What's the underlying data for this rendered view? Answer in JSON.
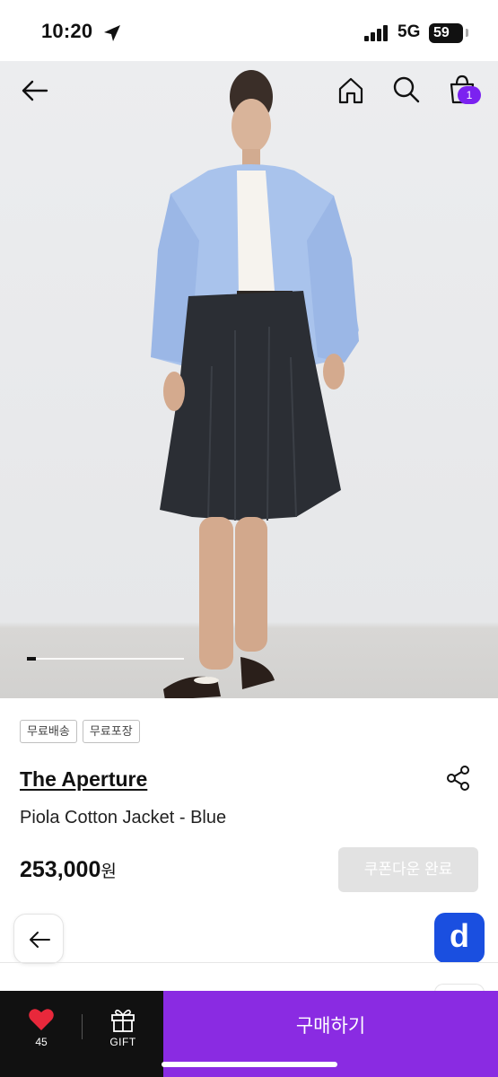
{
  "status_bar": {
    "time": "10:20",
    "network": "5G",
    "battery": "59"
  },
  "header": {
    "cart_count": "1"
  },
  "tags": [
    "무료배송",
    "무료포장"
  ],
  "product": {
    "brand": "The Aperture",
    "name": "Piola Cotton Jacket - Blue",
    "price": "253,000",
    "currency": "원"
  },
  "coupon_button": "쿠폰다운 완료",
  "app_logo": "d",
  "bottom_bar": {
    "like_count": "45",
    "gift_label": "GIFT",
    "buy_label": "구매하기"
  },
  "colors": {
    "accent": "#8a2be2",
    "badge": "#7b22f0",
    "logo": "#1a4fe0",
    "like": "#e8283b"
  }
}
